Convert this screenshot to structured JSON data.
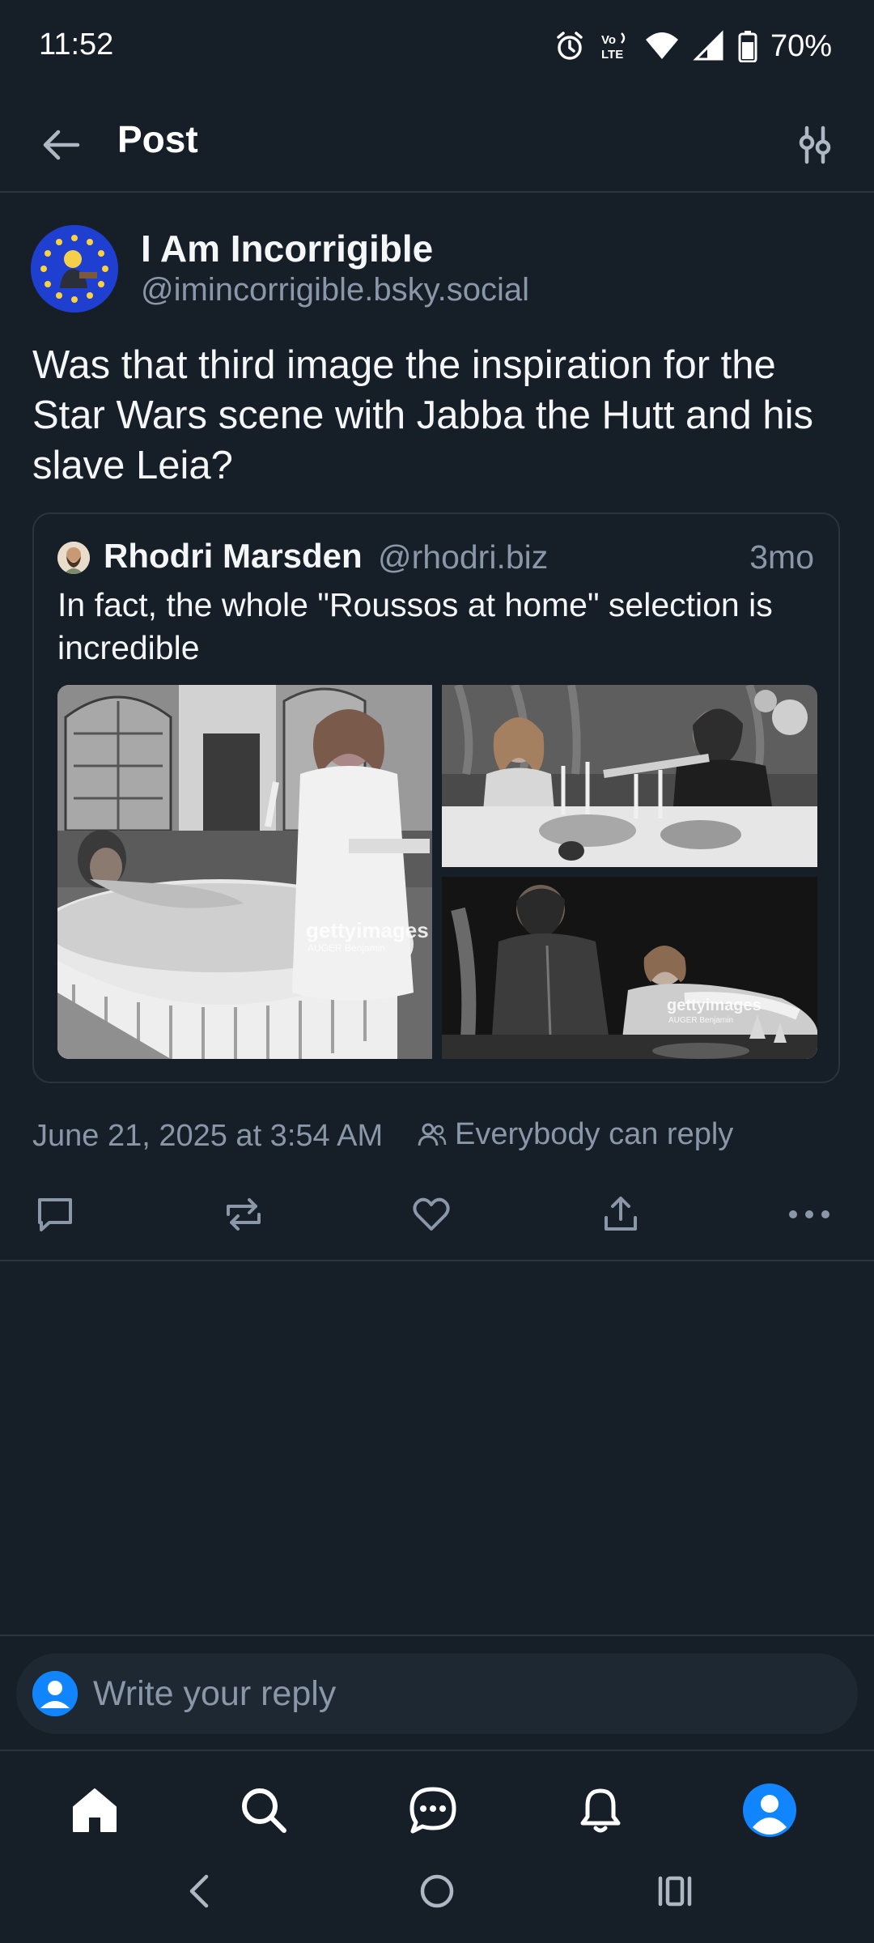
{
  "status_bar": {
    "time": "11:52",
    "battery": "70%",
    "icons": [
      "alarm-icon",
      "volte-icon",
      "wifi-icon",
      "signal-icon",
      "battery-icon"
    ]
  },
  "header": {
    "title": "Post",
    "back_icon": "arrow-left-icon",
    "filter_icon": "sliders-icon"
  },
  "post": {
    "author_name": "I Am Incorrigible",
    "author_handle": "@imincorrigible.bsky.social",
    "text": "Was that third image the inspiration for the Star Wars scene with Jabba the Hutt and his slave Leia?",
    "date": "June 21, 2025 at 3:54 AM",
    "reply_setting": "Everybody can reply"
  },
  "quote": {
    "author_name": "Rhodri Marsden",
    "author_handle": "@rhodri.biz",
    "time": "3mo",
    "text": "In fact, the whole \"Roussos at home\" selection is incredible",
    "images": [
      {
        "watermark": "gettyimages",
        "credit": "AUGER Benjamin"
      },
      {
        "watermark": "",
        "credit": ""
      },
      {
        "watermark": "gettyimages",
        "credit": "AUGER Benjamin"
      }
    ]
  },
  "actions": [
    "reply-icon",
    "repost-icon",
    "like-icon",
    "share-icon",
    "more-icon"
  ],
  "composer": {
    "placeholder": "Write your reply"
  },
  "bottom_nav": [
    "home-icon",
    "search-icon",
    "chat-icon",
    "bell-icon",
    "profile-icon"
  ],
  "system_nav": [
    "back-nav-icon",
    "home-nav-icon",
    "recents-nav-icon"
  ],
  "colors": {
    "background": "#161e27",
    "text_secondary": "#8a97a8",
    "accent": "#1185fe",
    "divider": "#2a3441"
  }
}
